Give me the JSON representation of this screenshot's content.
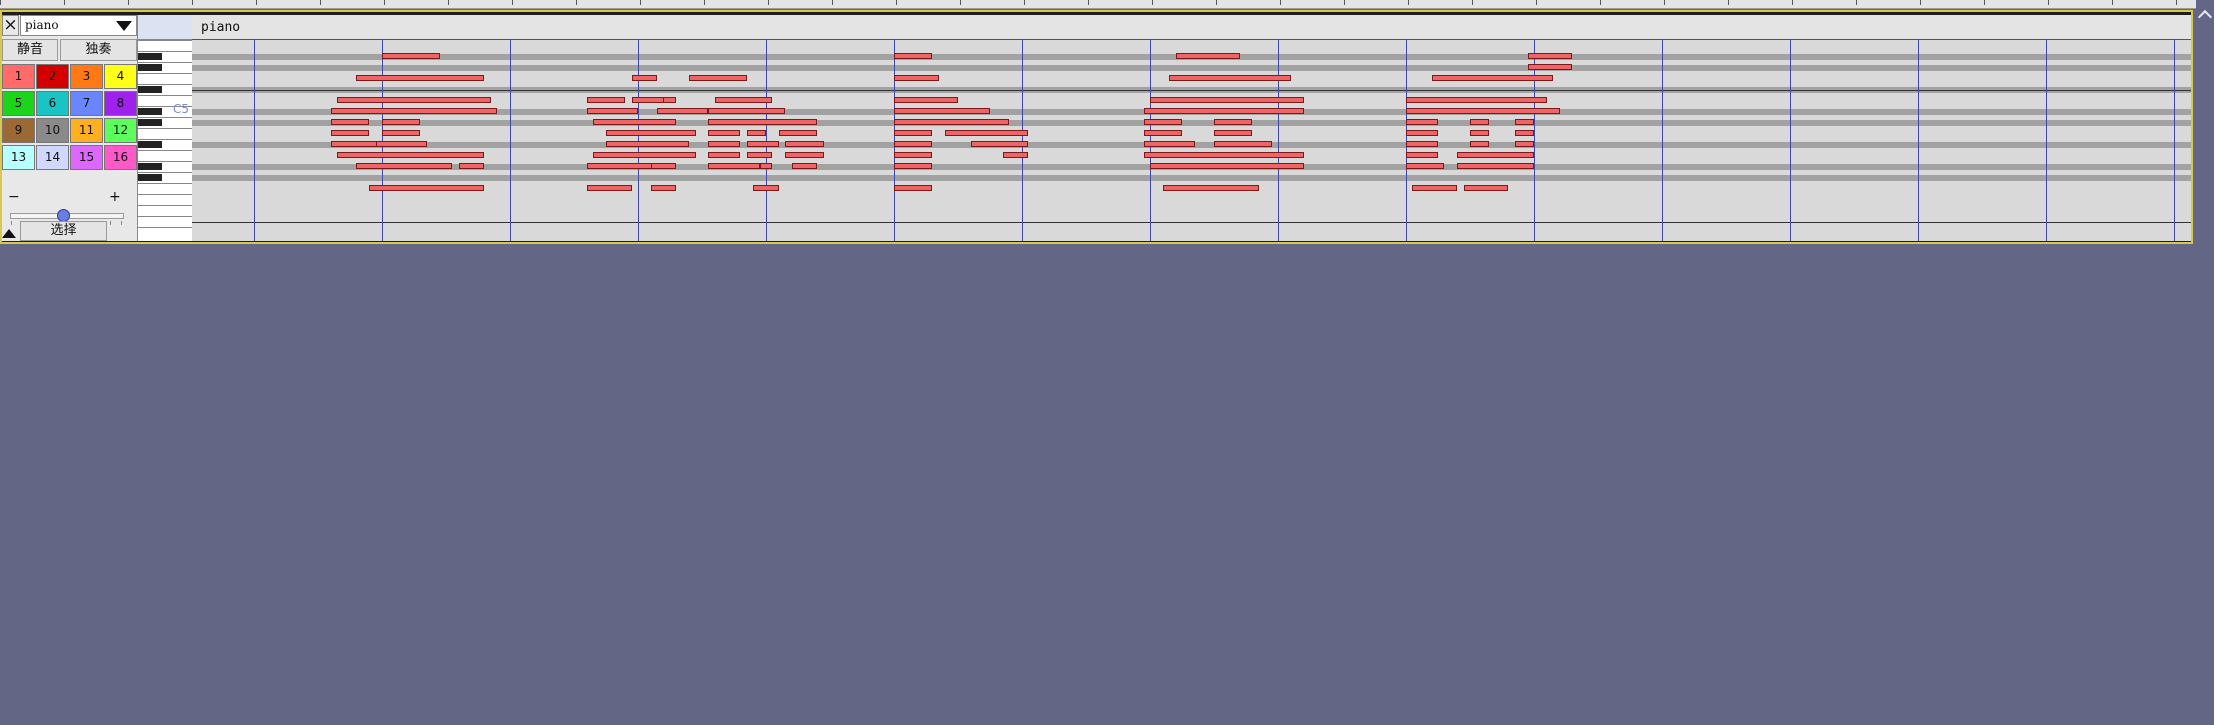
{
  "colors": {
    "background": "#636685",
    "note": "#ef6464",
    "beat_line": "#3d47a8",
    "track_frame": "#d8c850"
  },
  "track": {
    "close_icon": "close-icon",
    "close_symbol": "×",
    "instrument": "piano",
    "name": "piano",
    "mute_label": "静音",
    "solo_label": "独奏",
    "volume_minus": "−",
    "volume_plus": "+",
    "select_label": "选择",
    "octave_label": "C5",
    "channels": [
      {
        "label": "1",
        "color": "#ff6a6a"
      },
      {
        "label": "2",
        "color": "#d40000"
      },
      {
        "label": "3",
        "color": "#ff7a14"
      },
      {
        "label": "4",
        "color": "#ffff1a"
      },
      {
        "label": "5",
        "color": "#1cd41c"
      },
      {
        "label": "6",
        "color": "#18c4c4"
      },
      {
        "label": "7",
        "color": "#6a86ff"
      },
      {
        "label": "8",
        "color": "#a020f0"
      },
      {
        "label": "9",
        "color": "#9c6834"
      },
      {
        "label": "10",
        "color": "#8a8a8a"
      },
      {
        "label": "11",
        "color": "#ffb020"
      },
      {
        "label": "12",
        "color": "#5cff5c"
      },
      {
        "label": "13",
        "color": "#b8ffff"
      },
      {
        "label": "14",
        "color": "#d0d8ff"
      },
      {
        "label": "15",
        "color": "#dc68ff"
      },
      {
        "label": "16",
        "color": "#ff58c8"
      }
    ],
    "notes": [
      {
        "row": 1,
        "start": 2.0,
        "end": 2.9
      },
      {
        "row": 1,
        "start": 10.0,
        "end": 10.6
      },
      {
        "row": 1,
        "start": 14.4,
        "end": 15.4
      },
      {
        "row": 1,
        "start": 19.9,
        "end": 20.6
      },
      {
        "row": 2,
        "start": 19.9,
        "end": 20.6
      },
      {
        "row": 3,
        "start": 1.6,
        "end": 3.6
      },
      {
        "row": 3,
        "start": 5.9,
        "end": 6.3
      },
      {
        "row": 3,
        "start": 6.8,
        "end": 7.7
      },
      {
        "row": 3,
        "start": 10.0,
        "end": 10.7
      },
      {
        "row": 3,
        "start": 14.3,
        "end": 16.2
      },
      {
        "row": 3,
        "start": 18.4,
        "end": 20.3
      },
      {
        "row": 5,
        "start": 1.3,
        "end": 3.7
      },
      {
        "row": 5,
        "start": 5.2,
        "end": 5.8
      },
      {
        "row": 5,
        "start": 6.2,
        "end": 6.6
      },
      {
        "row": 5,
        "start": 5.9,
        "end": 6.4
      },
      {
        "row": 5,
        "start": 7.2,
        "end": 8.1
      },
      {
        "row": 5,
        "start": 10.0,
        "end": 11.0
      },
      {
        "row": 5,
        "start": 14.0,
        "end": 16.4
      },
      {
        "row": 5,
        "start": 18.0,
        "end": 20.2
      },
      {
        "row": 6,
        "start": 1.2,
        "end": 3.8
      },
      {
        "row": 6,
        "start": 5.2,
        "end": 6.0
      },
      {
        "row": 6,
        "start": 6.3,
        "end": 7.1
      },
      {
        "row": 6,
        "start": 7.1,
        "end": 8.3
      },
      {
        "row": 6,
        "start": 10.0,
        "end": 11.5
      },
      {
        "row": 6,
        "start": 13.9,
        "end": 16.4
      },
      {
        "row": 6,
        "start": 18.0,
        "end": 20.4
      },
      {
        "row": 7,
        "start": 1.2,
        "end": 1.8
      },
      {
        "row": 7,
        "start": 2.0,
        "end": 2.6
      },
      {
        "row": 7,
        "start": 5.3,
        "end": 6.6
      },
      {
        "row": 7,
        "start": 7.1,
        "end": 8.8
      },
      {
        "row": 7,
        "start": 10.0,
        "end": 11.8
      },
      {
        "row": 7,
        "start": 13.9,
        "end": 14.5
      },
      {
        "row": 7,
        "start": 15.0,
        "end": 15.6
      },
      {
        "row": 7,
        "start": 18.0,
        "end": 18.5
      },
      {
        "row": 7,
        "start": 19.0,
        "end": 19.3
      },
      {
        "row": 7,
        "start": 19.7,
        "end": 20.0
      },
      {
        "row": 8,
        "start": 1.2,
        "end": 1.8
      },
      {
        "row": 8,
        "start": 2.0,
        "end": 2.6
      },
      {
        "row": 8,
        "start": 5.5,
        "end": 6.9
      },
      {
        "row": 8,
        "start": 7.1,
        "end": 7.6
      },
      {
        "row": 8,
        "start": 7.7,
        "end": 8.0
      },
      {
        "row": 8,
        "start": 8.2,
        "end": 8.8
      },
      {
        "row": 8,
        "start": 10.0,
        "end": 10.6
      },
      {
        "row": 8,
        "start": 10.8,
        "end": 12.1
      },
      {
        "row": 8,
        "start": 13.9,
        "end": 14.5
      },
      {
        "row": 8,
        "start": 15.0,
        "end": 15.6
      },
      {
        "row": 8,
        "start": 18.0,
        "end": 18.5
      },
      {
        "row": 8,
        "start": 19.0,
        "end": 19.3
      },
      {
        "row": 8,
        "start": 19.7,
        "end": 20.0
      },
      {
        "row": 9,
        "start": 1.2,
        "end": 2.0
      },
      {
        "row": 9,
        "start": 1.9,
        "end": 2.7
      },
      {
        "row": 9,
        "start": 5.5,
        "end": 6.8
      },
      {
        "row": 9,
        "start": 7.1,
        "end": 7.6
      },
      {
        "row": 9,
        "start": 7.7,
        "end": 8.2
      },
      {
        "row": 9,
        "start": 8.3,
        "end": 8.9
      },
      {
        "row": 9,
        "start": 10.0,
        "end": 10.6
      },
      {
        "row": 9,
        "start": 11.2,
        "end": 12.1
      },
      {
        "row": 9,
        "start": 13.9,
        "end": 14.7
      },
      {
        "row": 9,
        "start": 15.0,
        "end": 15.9
      },
      {
        "row": 9,
        "start": 18.0,
        "end": 18.5
      },
      {
        "row": 9,
        "start": 19.0,
        "end": 19.3
      },
      {
        "row": 9,
        "start": 19.7,
        "end": 20.0
      },
      {
        "row": 10,
        "start": 1.3,
        "end": 3.6
      },
      {
        "row": 10,
        "start": 5.3,
        "end": 6.9
      },
      {
        "row": 10,
        "start": 7.1,
        "end": 7.6
      },
      {
        "row": 10,
        "start": 7.7,
        "end": 8.1
      },
      {
        "row": 10,
        "start": 8.3,
        "end": 8.9
      },
      {
        "row": 10,
        "start": 10.0,
        "end": 10.6
      },
      {
        "row": 10,
        "start": 11.7,
        "end": 12.1
      },
      {
        "row": 10,
        "start": 13.9,
        "end": 16.4
      },
      {
        "row": 10,
        "start": 18.0,
        "end": 18.5
      },
      {
        "row": 10,
        "start": 18.8,
        "end": 20.0
      },
      {
        "row": 11,
        "start": 1.6,
        "end": 3.1
      },
      {
        "row": 11,
        "start": 3.2,
        "end": 3.6
      },
      {
        "row": 11,
        "start": 5.2,
        "end": 6.6
      },
      {
        "row": 11,
        "start": 6.2,
        "end": 6.6
      },
      {
        "row": 11,
        "start": 7.1,
        "end": 7.9
      },
      {
        "row": 11,
        "start": 7.9,
        "end": 8.1
      },
      {
        "row": 11,
        "start": 8.4,
        "end": 8.8
      },
      {
        "row": 11,
        "start": 10.0,
        "end": 10.6
      },
      {
        "row": 11,
        "start": 14.0,
        "end": 16.4
      },
      {
        "row": 11,
        "start": 18.0,
        "end": 18.6
      },
      {
        "row": 11,
        "start": 18.8,
        "end": 20.0
      },
      {
        "row": 13,
        "start": 1.8,
        "end": 3.6
      },
      {
        "row": 13,
        "start": 5.2,
        "end": 5.9
      },
      {
        "row": 13,
        "start": 6.2,
        "end": 6.6
      },
      {
        "row": 13,
        "start": 7.8,
        "end": 8.2
      },
      {
        "row": 13,
        "start": 10.0,
        "end": 10.6
      },
      {
        "row": 13,
        "start": 14.2,
        "end": 15.7
      },
      {
        "row": 13,
        "start": 18.1,
        "end": 18.8
      },
      {
        "row": 13,
        "start": 18.9,
        "end": 19.6
      }
    ]
  }
}
